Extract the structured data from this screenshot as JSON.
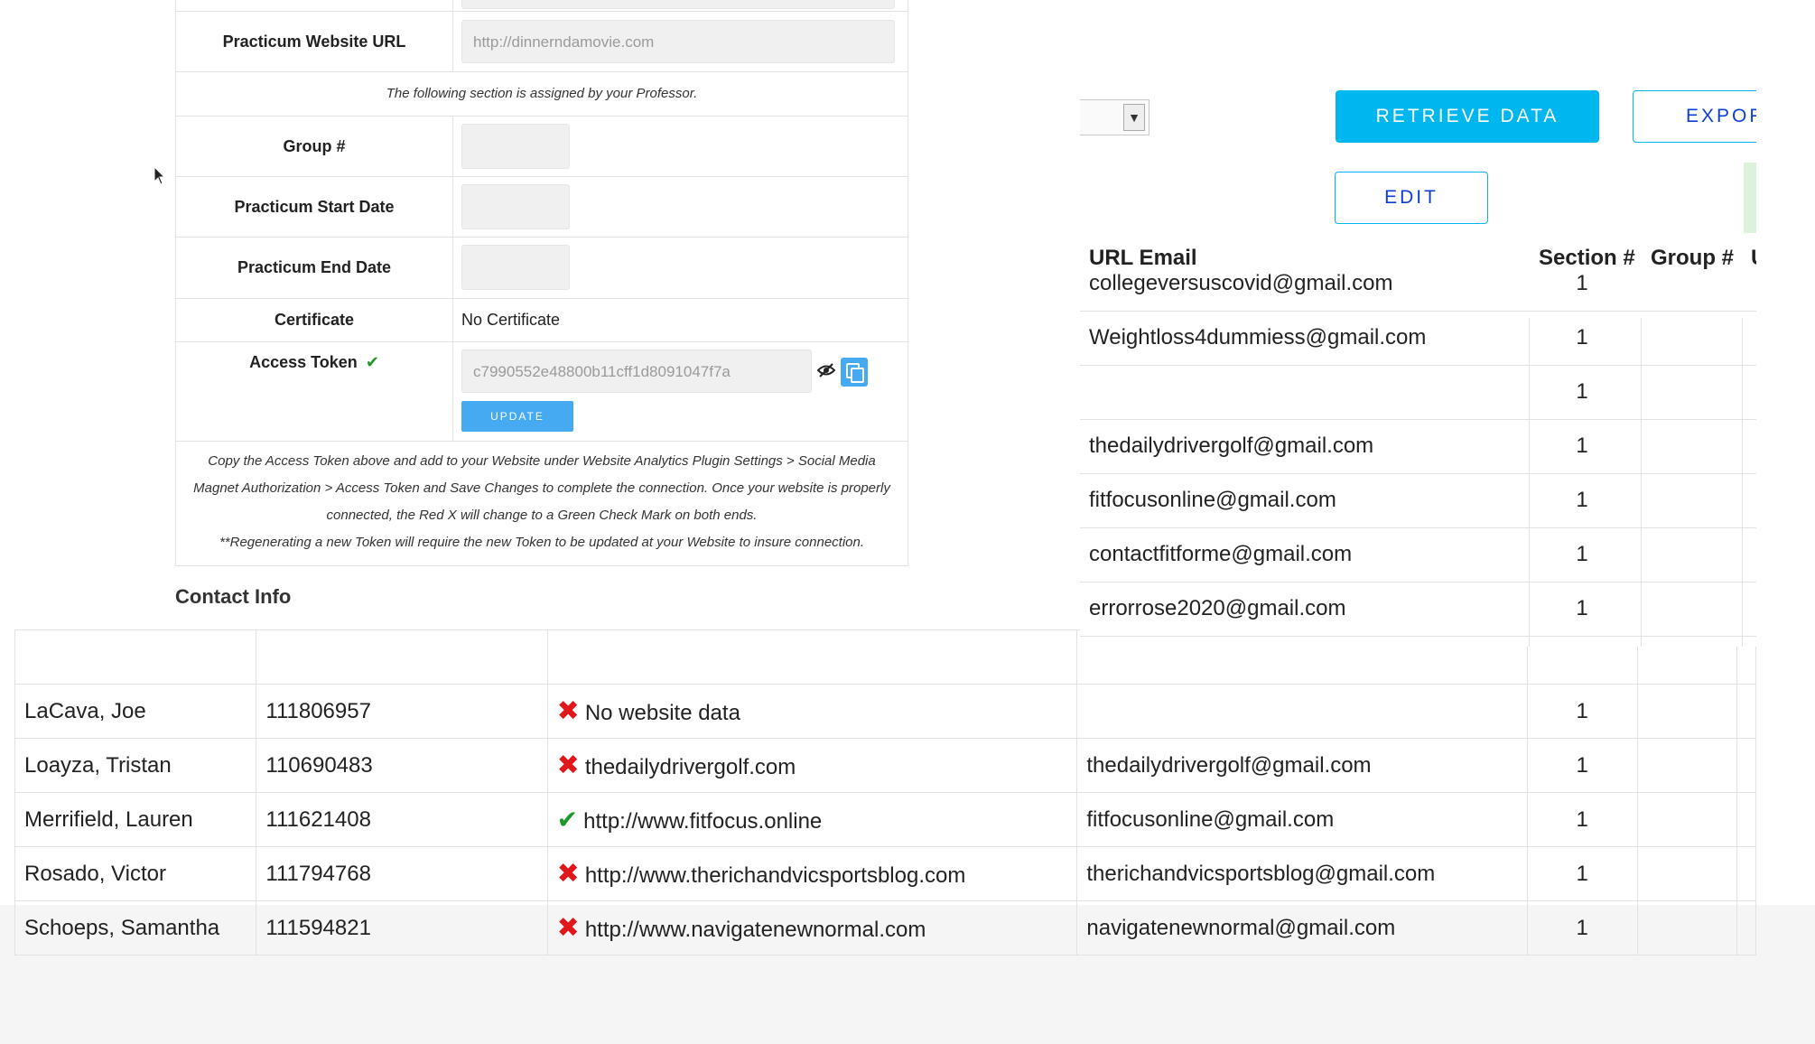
{
  "form": {
    "website_url_label": "Practicum Website URL",
    "website_url_placeholder": "http://dinnerndamovie.com",
    "section_note": "The following section is assigned by your Professor.",
    "group_label": "Group #",
    "start_date_label": "Practicum Start Date",
    "end_date_label": "Practicum End Date",
    "certificate_label": "Certificate",
    "certificate_value": "No Certificate",
    "access_token_label": "Access Token",
    "access_token_value": "c7990552e48800b11cff1d8091047f7a",
    "update_label": "UPDATE",
    "instructions": "Copy the Access Token above and add to your Website under Website Analytics Plugin Settings > Social Media Magnet Authorization > Access Token and Save Changes to complete the connection. Once your website is properly connected, the Red X will change to a Green Check Mark on both ends.",
    "regenerate_note": "**Regenerating a new Token will require the new Token to be updated at your Website to insure connection.",
    "contact_info": "Contact Info"
  },
  "toolbar": {
    "retrieve_label": "RETRIEVE DATA",
    "export_label": "EXPORT",
    "edit_label": "EDIT"
  },
  "right_table": {
    "headers": {
      "email": "URL Email",
      "section": "Section #",
      "group": "Group #",
      "cut": "U"
    },
    "rows": [
      {
        "email": "collegeversuscovid@gmail.com",
        "section": "1"
      },
      {
        "email": "Weightloss4dummiess@gmail.com",
        "section": "1"
      },
      {
        "email": "",
        "section": "1"
      },
      {
        "email": "thedailydrivergolf@gmail.com",
        "section": "1"
      },
      {
        "email": "fitfocusonline@gmail.com",
        "section": "1"
      },
      {
        "email": "contactfitforme@gmail.com",
        "section": "1"
      },
      {
        "email": "errorrose2020@gmail.com",
        "section": "1"
      }
    ]
  },
  "main_table": {
    "rows": [
      {
        "name": "LaCava, Joe",
        "id": "111806957",
        "status": "x",
        "url": "No website data",
        "email": "",
        "section": "1"
      },
      {
        "name": "Loayza, Tristan",
        "id": "110690483",
        "status": "x",
        "url": "thedailydrivergolf.com",
        "email": "thedailydrivergolf@gmail.com",
        "section": "1"
      },
      {
        "name": "Merrifield, Lauren",
        "id": "111621408",
        "status": "check",
        "url": "http://www.fitfocus.online",
        "email": "fitfocusonline@gmail.com",
        "section": "1"
      },
      {
        "name": "Rosado, Victor",
        "id": "111794768",
        "status": "x",
        "url": "http://www.therichandvicsportsblog.com",
        "email": "therichandvicsportsblog@gmail.com",
        "section": "1"
      },
      {
        "name": "Schoeps, Samantha",
        "id": "111594821",
        "status": "x",
        "url": "http://www.navigatenewnormal.com",
        "email": "navigatenewnormal@gmail.com",
        "section": "1"
      }
    ]
  },
  "colors": {
    "accent": "#00b6ef",
    "link_text": "#0d3fd8",
    "error": "#e0181b",
    "success": "#1f9a2a"
  },
  "icons": [
    "x-mark-icon",
    "check-mark-icon",
    "eye-slash-icon",
    "copy-icon",
    "dropdown-arrow-icon",
    "cursor-icon"
  ]
}
